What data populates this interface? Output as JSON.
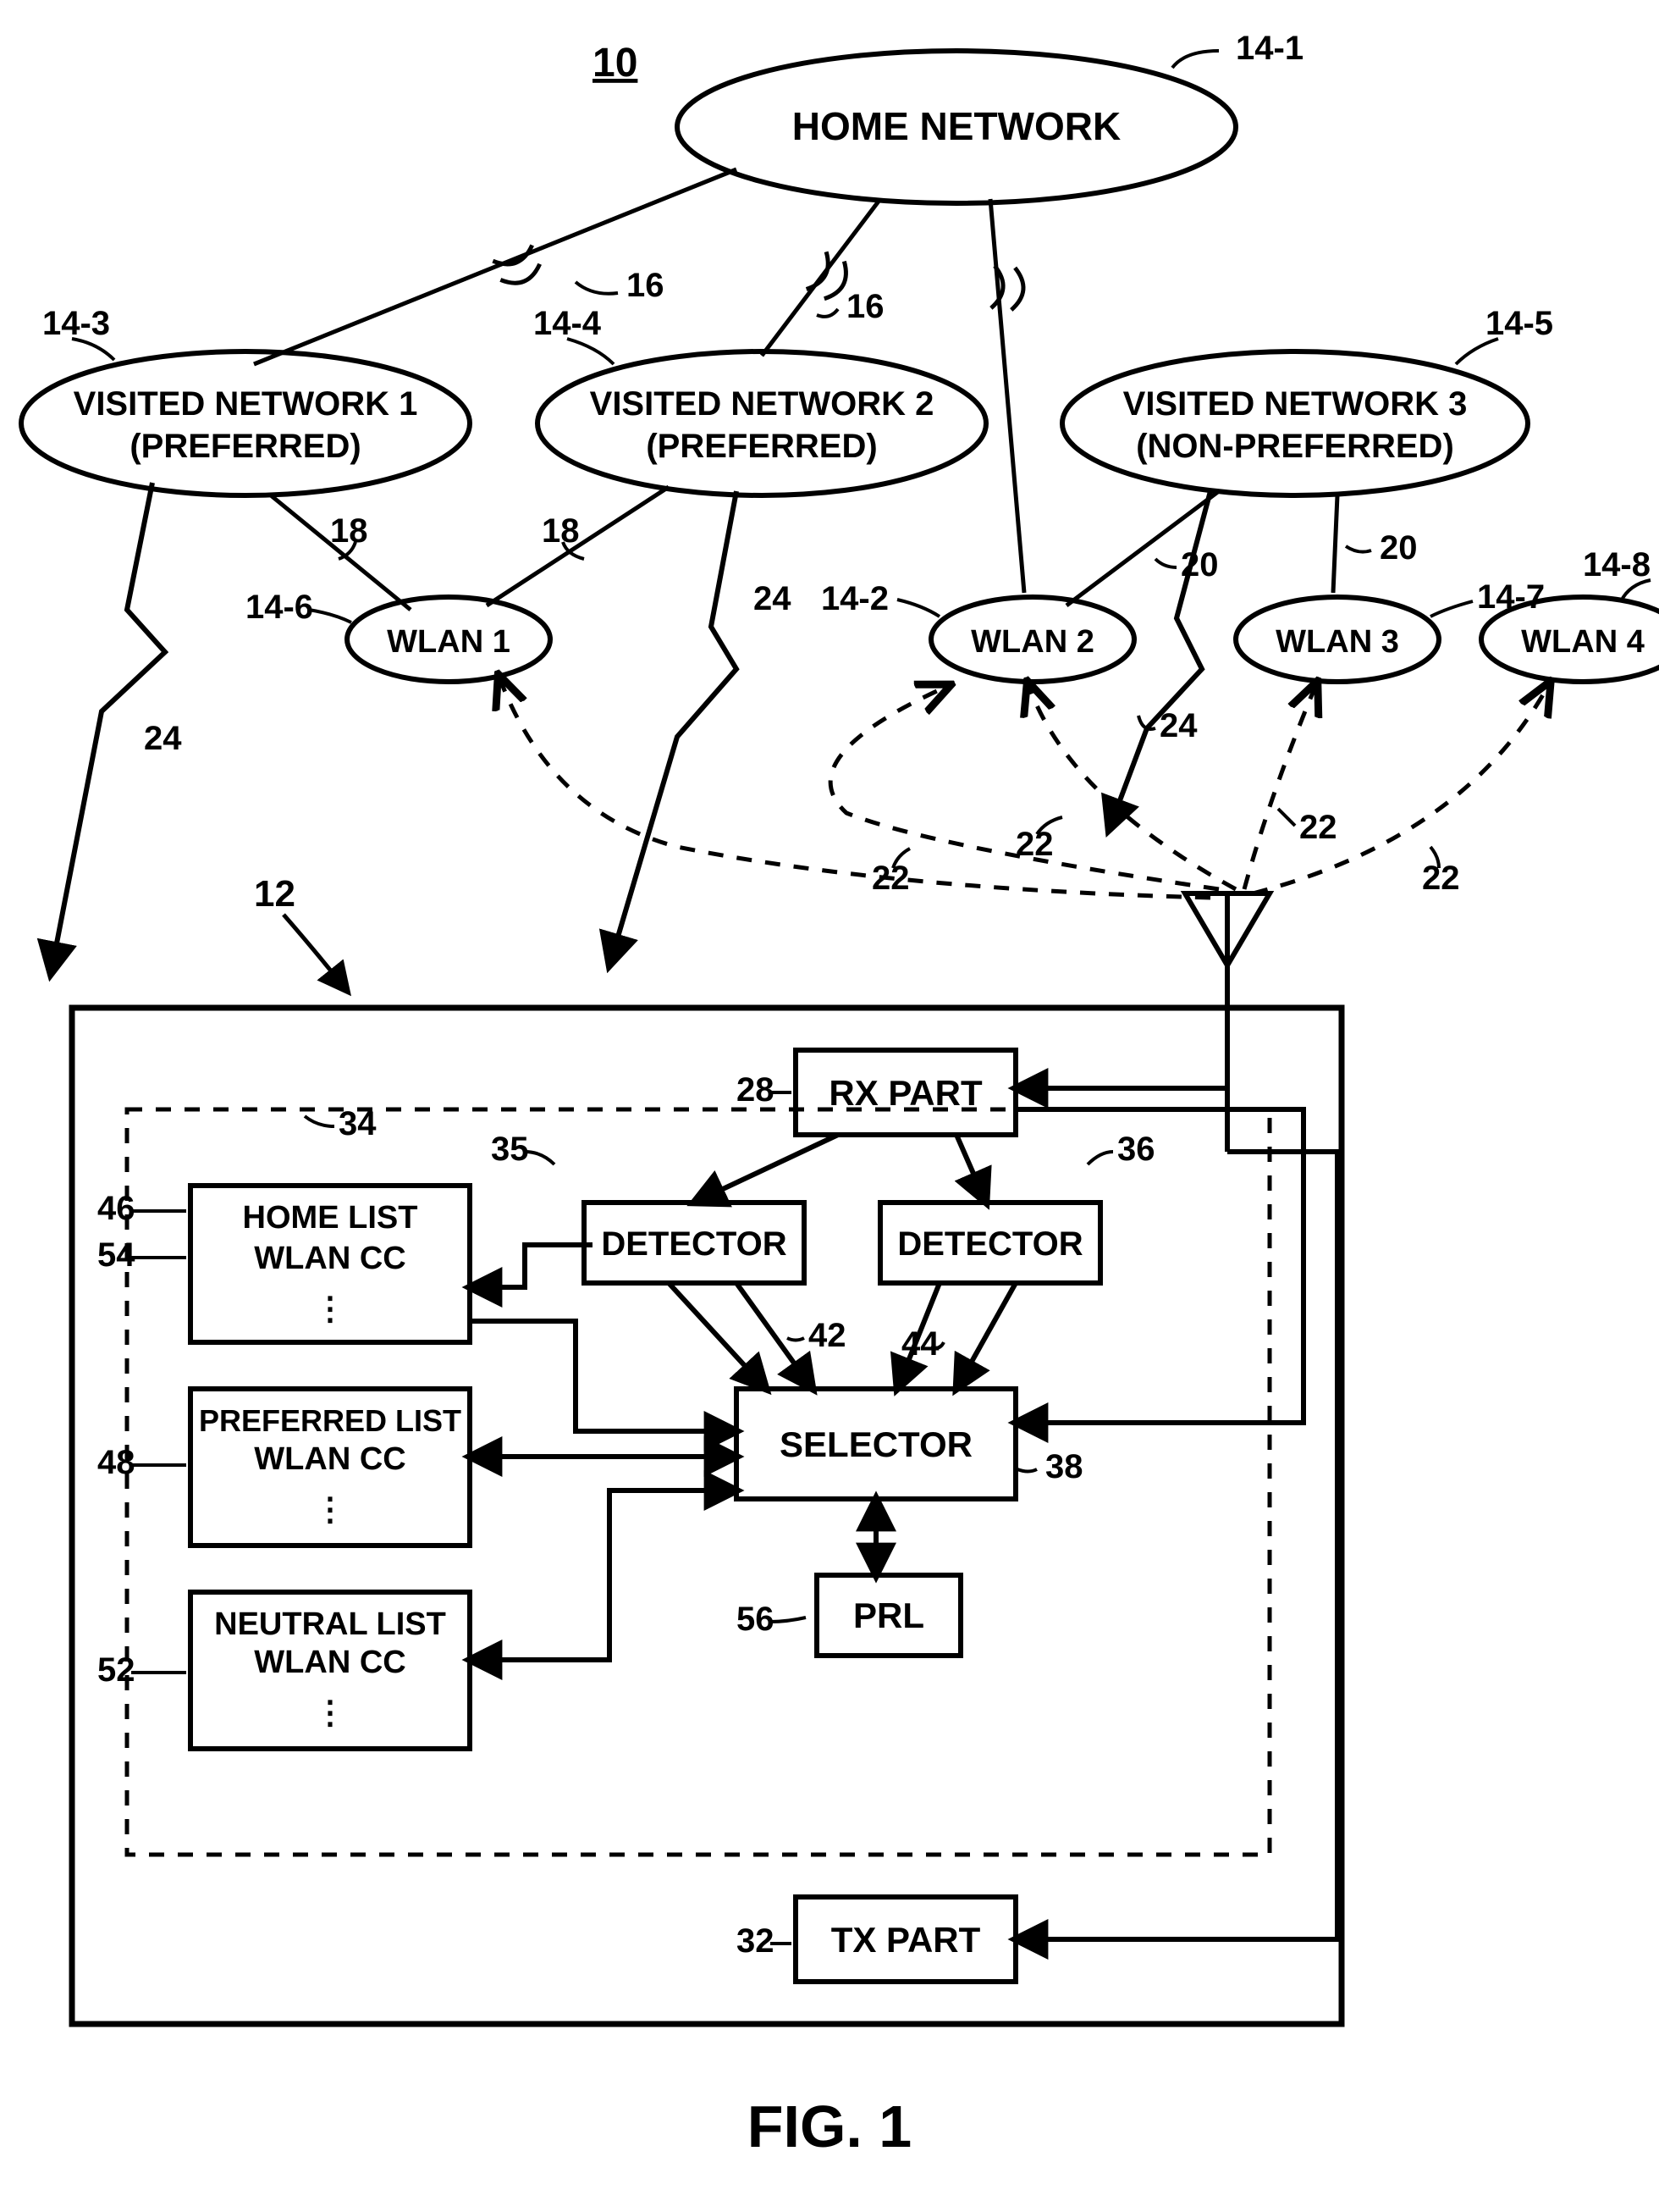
{
  "figure": {
    "id_label": "10",
    "caption": "FIG. 1"
  },
  "networks": {
    "home": {
      "label": "HOME NETWORK",
      "ref": "14-1"
    },
    "visited1": {
      "label1": "VISITED NETWORK 1",
      "label2": "(PREFERRED)",
      "ref": "14-3"
    },
    "visited2": {
      "label1": "VISITED NETWORK 2",
      "label2": "(PREFERRED)",
      "ref": "14-4"
    },
    "visited3": {
      "label1": "VISITED NETWORK 3",
      "label2": "(NON-PREFERRED)",
      "ref": "14-5"
    },
    "wlan1": {
      "label": "WLAN 1",
      "ref": "14-6"
    },
    "wlan2": {
      "label": "WLAN 2",
      "ref": "14-2"
    },
    "wlan3": {
      "label": "WLAN 3",
      "ref": "14-7"
    },
    "wlan4": {
      "label": "WLAN 4",
      "ref": "14-8"
    }
  },
  "link_refs": {
    "a16a": "16",
    "a16b": "16",
    "a18a": "18",
    "a18b": "18",
    "a20a": "20",
    "a20b": "20",
    "a24a": "24",
    "a24b": "24",
    "a24c": "24",
    "a22a": "22",
    "a22b": "22",
    "a22c": "22",
    "a22d": "22",
    "a12": "12"
  },
  "device": {
    "rx": {
      "label": "RX PART",
      "ref": "28"
    },
    "tx": {
      "label": "TX PART",
      "ref": "32"
    },
    "detector_left": {
      "label": "DETECTOR",
      "ref": "35"
    },
    "detector_right": {
      "label": "DETECTOR",
      "ref": "36"
    },
    "selector": {
      "label": "SELECTOR",
      "ref": "38"
    },
    "prl": {
      "label": "PRL",
      "ref": "56"
    },
    "dash_ref": "34",
    "arrow42": "42",
    "arrow44": "44",
    "lists": {
      "home": {
        "line1": "HOME LIST",
        "line2": "WLAN CC",
        "ref": "46",
        "side_ref": "54"
      },
      "preferred": {
        "line1": "PREFERRED LIST",
        "line2": "WLAN CC",
        "ref": "48"
      },
      "neutral": {
        "line1": "NEUTRAL LIST",
        "line2": "WLAN CC",
        "ref": "52"
      }
    }
  }
}
